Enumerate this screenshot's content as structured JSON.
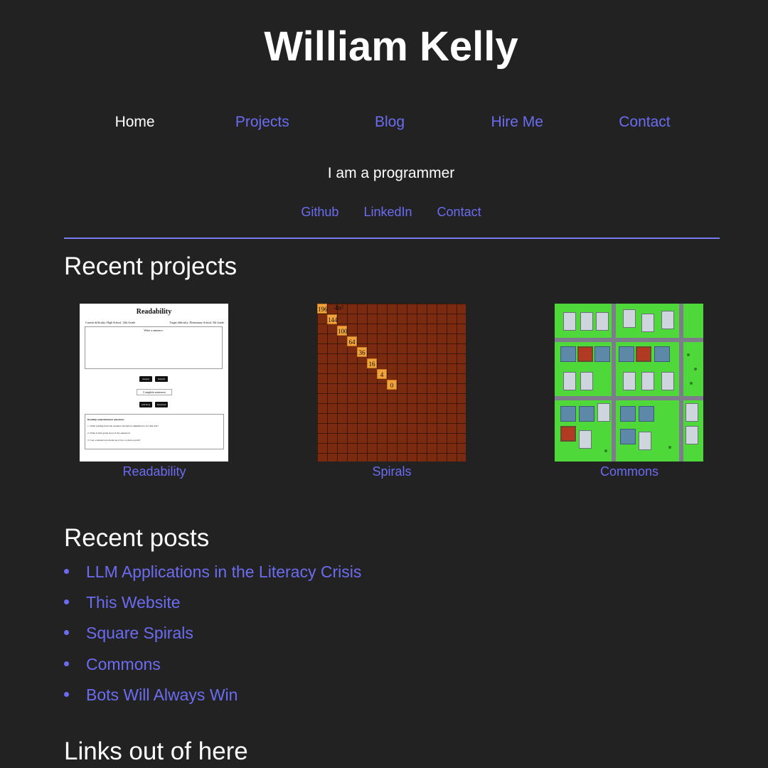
{
  "site": {
    "title": "William Kelly"
  },
  "nav": {
    "items": [
      {
        "label": "Home",
        "active": true
      },
      {
        "label": "Projects",
        "active": false
      },
      {
        "label": "Blog",
        "active": false
      },
      {
        "label": "Hire Me",
        "active": false
      },
      {
        "label": "Contact",
        "active": false
      }
    ]
  },
  "tagline": "I am a programmer",
  "social": {
    "links": [
      {
        "label": "Github"
      },
      {
        "label": "LinkedIn"
      },
      {
        "label": "Contact"
      }
    ]
  },
  "recent_projects": {
    "heading": "Recent projects",
    "items": [
      {
        "caption": "Readability",
        "thumbnail": "readability-screenshot"
      },
      {
        "caption": "Spirals",
        "thumbnail": "spirals-grid"
      },
      {
        "caption": "Commons",
        "thumbnail": "commons-city-game"
      }
    ]
  },
  "readability_thumb": {
    "title": "Readability",
    "current_difficulty": "Current difficulty: High School, 12th Grade",
    "target_difficulty": "Target difficulty: Elementary School, 5th Grade",
    "placeholder": "Write a sentence.",
    "buttons": [
      "Analyze",
      "Simplify",
      "Add Story",
      "Download"
    ],
    "select": "Complete sentences",
    "questions_title": "Reading comprehension questions:",
    "questions": [
      "1. What reading level the sentence should be simplified to for this text?",
      "2. What is that grade level of the sentence?",
      "3. Can a sentence be made up of two or more words?"
    ]
  },
  "spirals_thumb": {
    "label": "4n²",
    "values": [
      "196",
      "144",
      "100",
      "64",
      "36",
      "16",
      "4",
      "0"
    ]
  },
  "recent_posts": {
    "heading": "Recent posts",
    "items": [
      {
        "title": "LLM Applications in the Literacy Crisis"
      },
      {
        "title": "This Website"
      },
      {
        "title": "Square Spirals"
      },
      {
        "title": "Commons"
      },
      {
        "title": "Bots Will Always Win"
      }
    ]
  },
  "links_out": {
    "heading": "Links out of here"
  },
  "colors": {
    "background": "#222222",
    "link": "#6c6cf2",
    "text": "#ffffff",
    "divider": "#7a7af0"
  }
}
